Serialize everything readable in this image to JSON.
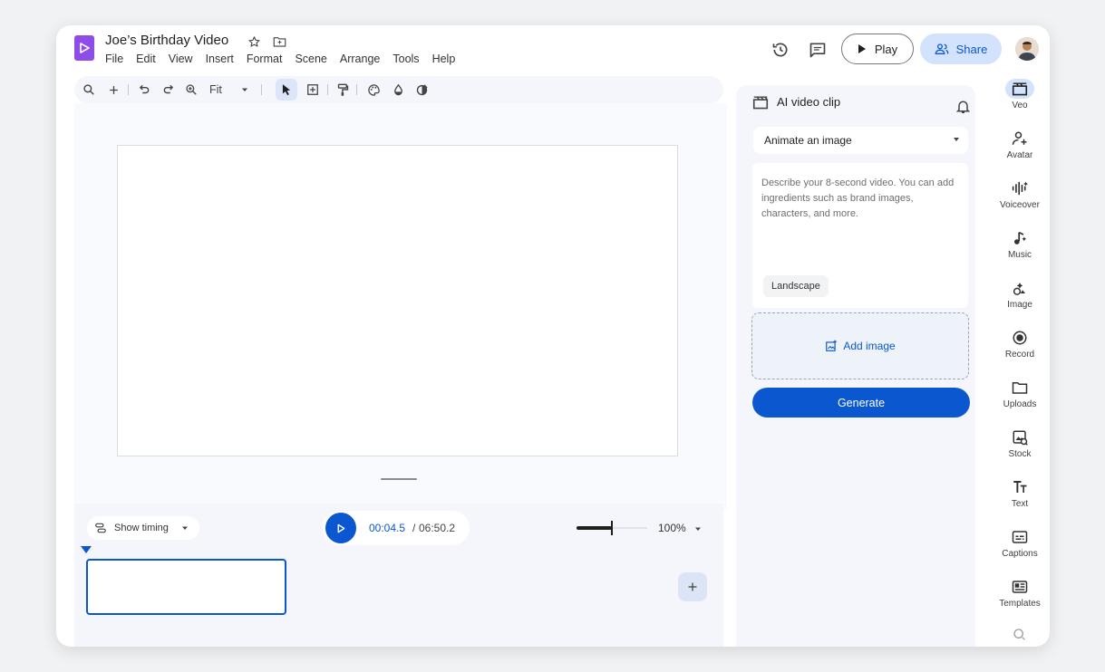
{
  "header": {
    "doc_title": "Joe’s Birthday Video",
    "menu": [
      "File",
      "Edit",
      "View",
      "Insert",
      "Format",
      "Scene",
      "Arrange",
      "Tools",
      "Help"
    ],
    "play_label": "Play",
    "share_label": "Share"
  },
  "toolbar": {
    "zoom_fit_label": "Fit"
  },
  "timeline": {
    "show_timing_label": "Show timing",
    "current_time": "00:04.5",
    "total_time": "06:50.2",
    "time_separator": "/",
    "zoom_label": "100%",
    "zoom_level": 0.5
  },
  "panel": {
    "title": "AI video clip",
    "mode_selected": "Animate an image",
    "prompt_placeholder": "Describe your 8-second video. You can add ingredients such as brand images, characters, and more.",
    "aspect_chip": "Landscape",
    "add_image_label": "Add image",
    "generate_label": "Generate"
  },
  "rail": [
    {
      "label": "Veo",
      "icon": "veo-icon"
    },
    {
      "label": "Avatar",
      "icon": "avatar-icon"
    },
    {
      "label": "Voiceover",
      "icon": "voiceover-icon"
    },
    {
      "label": "Music",
      "icon": "music-icon"
    },
    {
      "label": "Image",
      "icon": "image-icon"
    },
    {
      "label": "Record",
      "icon": "record-icon"
    },
    {
      "label": "Uploads",
      "icon": "folder-icon"
    },
    {
      "label": "Stock",
      "icon": "stock-icon"
    },
    {
      "label": "Text",
      "icon": "text-icon"
    },
    {
      "label": "Captions",
      "icon": "captions-icon"
    },
    {
      "label": "Templates",
      "icon": "templates-icon"
    }
  ],
  "colors": {
    "accent": "#0b57d0",
    "share_bg": "#d3e3fd",
    "logo": "#8e4ce8"
  }
}
